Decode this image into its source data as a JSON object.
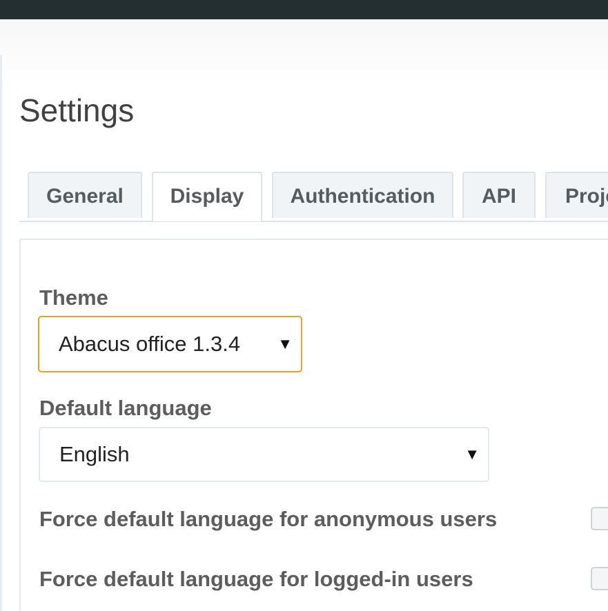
{
  "page": {
    "title": "Settings"
  },
  "tabs": [
    {
      "label": "General",
      "active": false
    },
    {
      "label": "Display",
      "active": true
    },
    {
      "label": "Authentication",
      "active": false
    },
    {
      "label": "API",
      "active": false
    },
    {
      "label": "Proje",
      "active": false
    }
  ],
  "form": {
    "theme": {
      "label": "Theme",
      "value": "Abacus office 1.3.4"
    },
    "default_language": {
      "label": "Default language",
      "value": "English"
    },
    "force_anonymous": {
      "label": "Force default language for anonymous users",
      "checked": false
    },
    "force_logged_in": {
      "label": "Force default language for logged-in users",
      "checked": false
    }
  },
  "icons": {
    "dropdown": "caret-down-icon",
    "caret_glyph": "▼"
  },
  "colors": {
    "topbar": "#232f31",
    "focus_border": "#e0a22c",
    "tab_background": "#f1f4f6",
    "label_text": "#5d5d5d"
  }
}
